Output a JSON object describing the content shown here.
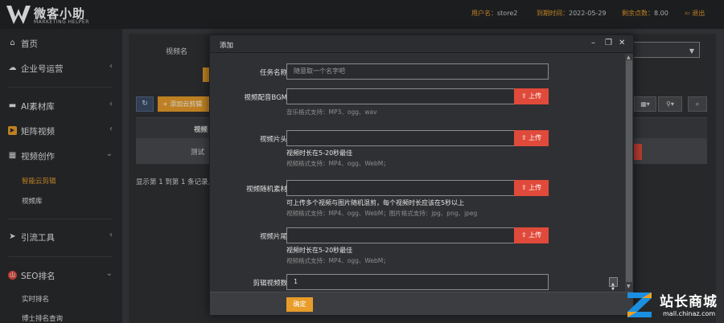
{
  "header": {
    "logo_title": "微客小助",
    "logo_sub": "MARKETING HELPER",
    "username_label": "用户名：",
    "username": "store2",
    "expiry_label": "到期时间：",
    "expiry": "2022-05-29",
    "points_label": "剩余点数：",
    "points": "8.00",
    "logout": "退出"
  },
  "sidebar": {
    "items": [
      {
        "label": "首页",
        "icon": "home-icon"
      },
      {
        "label": "企业号运营",
        "icon": "cloud-icon"
      },
      {
        "label": "AI素材库",
        "icon": "folder-icon"
      },
      {
        "label": "矩阵视频",
        "icon": "video-icon"
      },
      {
        "label": "视频创作",
        "icon": "film-icon"
      },
      {
        "label": "引流工具",
        "icon": "send-icon"
      },
      {
        "label": "SEO排名",
        "icon": "seo-icon"
      }
    ],
    "subitems_create": [
      "智能云剪辑",
      "视频库"
    ],
    "subitems_seo": [
      "实时排名",
      "博士排名查询"
    ]
  },
  "background": {
    "video_name_label": "视频名",
    "add_cloud_edit": "添加云剪辑",
    "table_header_video": "视频",
    "row_name": "测试",
    "footer": "显示第 1 到第 1 条记录,"
  },
  "modal": {
    "title": "添加",
    "fields": {
      "task_name_label": "任务名称",
      "task_name_placeholder": "随意取一个名字吧",
      "bgm_label": "视频配音BGM",
      "bgm_hint": "音乐格式支持：MP3、ogg、wav",
      "head_label": "视频片头",
      "head_hint1": "视频时长在5-20秒最佳",
      "head_hint2": "视频格式支持：MP4、ogg、WebM；",
      "random_label": "视频随机素材",
      "random_hint1": "可上传多个视频与图片随机混剪，每个视频时长应该在5秒以上",
      "random_hint2": "视频格式支持：MP4、ogg、WebM；图片格式支持：jpg、png、jpeg",
      "tail_label": "视频片尾",
      "tail_hint1": "视频时长在5-20秒最佳",
      "tail_hint2": "视频格式支持：MP4、ogg、WebM；",
      "count_label": "剪辑视频数",
      "count_value": "1"
    },
    "upload_label": "上传",
    "confirm": "确定"
  },
  "watermark": {
    "title": "站长商城",
    "sub": "mall.chinaz.com"
  },
  "colors": {
    "accent_orange": "#e89d2a",
    "upload_red": "#e04a3b"
  }
}
